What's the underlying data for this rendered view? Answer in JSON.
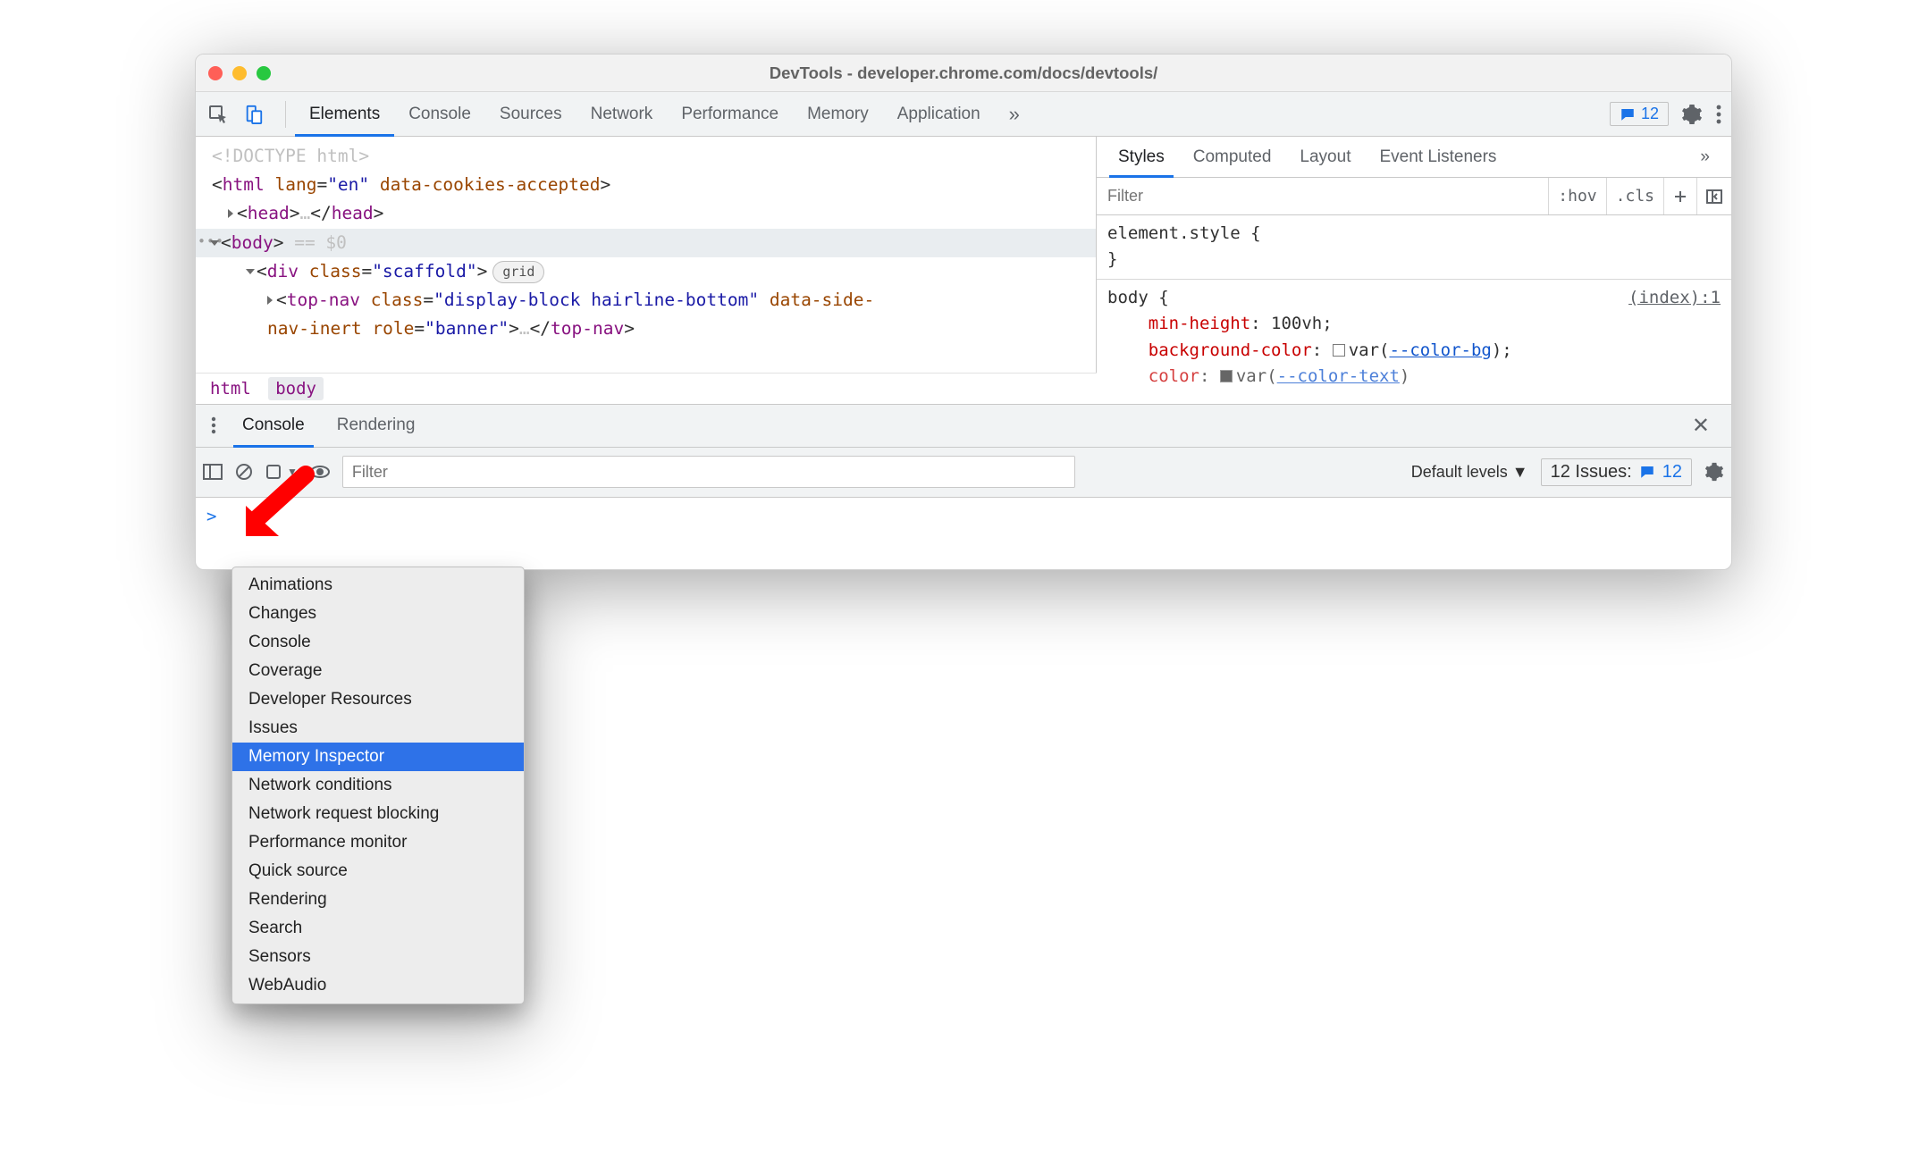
{
  "window_title": "DevTools - developer.chrome.com/docs/devtools/",
  "main_tabs": {
    "items": [
      "Elements",
      "Console",
      "Sources",
      "Network",
      "Performance",
      "Memory",
      "Application"
    ],
    "active": "Elements",
    "message_count": "12"
  },
  "dom": {
    "line0": "<!DOCTYPE html>",
    "html_open": {
      "tag": "html",
      "lang_attr": "lang",
      "lang_val": "\"en\"",
      "extra_attr": "data-cookies-accepted"
    },
    "head": {
      "open": "<head>",
      "ell": "…",
      "close": "</head>"
    },
    "body_marker": "== $0",
    "scaffold": {
      "tag": "div",
      "klass_attr": "class",
      "klass_val": "\"scaffold\"",
      "pill": "grid"
    },
    "topnav_line": "<top-nav class=\"display-block hairline-bottom\" data-side-",
    "topnav_line2_attrs": "nav-inert role=\"banner\">",
    "topnav_close": "</top-nav>",
    "topnav_ell": "…",
    "crumbs": {
      "a": "html",
      "b": "body"
    }
  },
  "styles": {
    "tabs": [
      "Styles",
      "Computed",
      "Layout",
      "Event Listeners"
    ],
    "filter_placeholder": "Filter",
    "hov": ":hov",
    "cls": ".cls",
    "elemstyle_open": "element.style {",
    "brace_close": "}",
    "body_sel": "body {",
    "file": "(index):1",
    "p1k": "min-height",
    "p1v": "100vh",
    "p2k": "background-color",
    "p2var": "--color-bg",
    "p3k": "color",
    "p3var": "--color-text",
    "var_label": "var"
  },
  "drawer": {
    "tabs": {
      "a": "Console",
      "b": "Rendering"
    },
    "filter_placeholder": "Filter",
    "levels": "Default levels ▼",
    "issues_label": "12 Issues:",
    "issues_count": "12",
    "prompt": ">"
  },
  "menu": {
    "items": [
      "Animations",
      "Changes",
      "Console",
      "Coverage",
      "Developer Resources",
      "Issues",
      "Memory Inspector",
      "Network conditions",
      "Network request blocking",
      "Performance monitor",
      "Quick source",
      "Rendering",
      "Search",
      "Sensors",
      "WebAudio"
    ],
    "selected": "Memory Inspector"
  }
}
